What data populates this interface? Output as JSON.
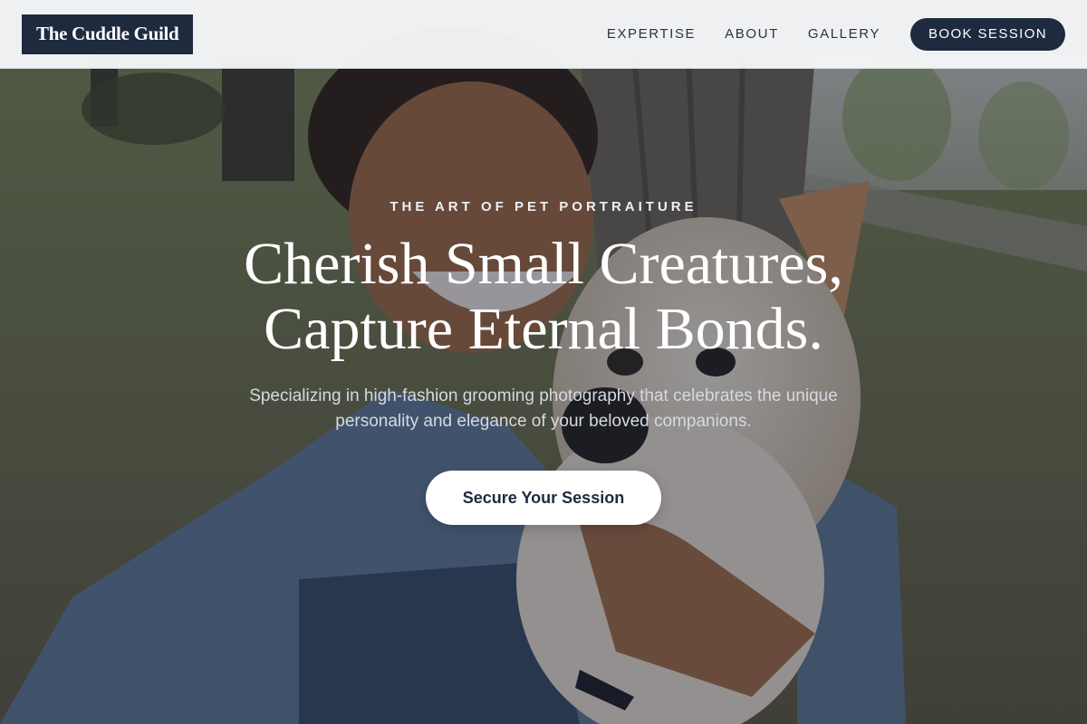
{
  "nav": {
    "logo": "The Cuddle Guild",
    "links": [
      "EXPERTISE",
      "ABOUT",
      "GALLERY"
    ],
    "cta": "BOOK SESSION"
  },
  "hero": {
    "eyebrow": "THE ART OF PET PORTRAITURE",
    "headline_line1": "Cherish Small Creatures,",
    "headline_line2": "Capture Eternal Bonds.",
    "subtext": "Specializing in high-fashion grooming photography that celebrates the unique personality and elegance of your beloved companions.",
    "cta": "Secure Your Session"
  },
  "colors": {
    "brand_navy": "#1e2a3e",
    "nav_background": "#f6f7f9",
    "cta_background": "#ffffff"
  }
}
